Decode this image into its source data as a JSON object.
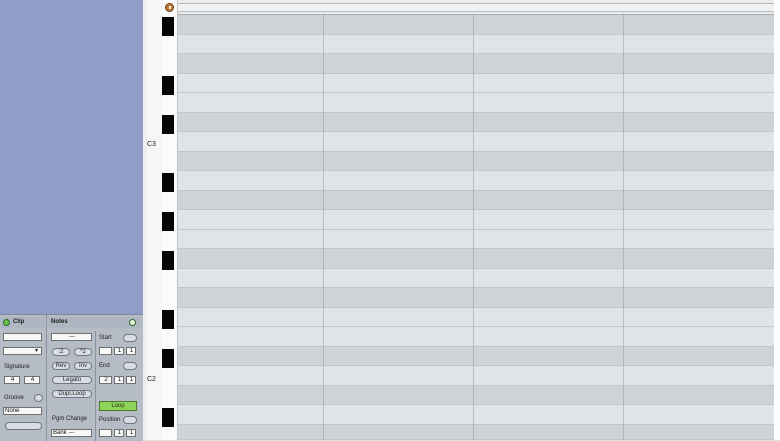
{
  "piano_roll": {
    "note_labels": {
      "c3": "C3",
      "c2": "C2"
    }
  },
  "clip_panel": {
    "clip_title": "Clip",
    "signature_label": "Signature",
    "signature_numerator": "4",
    "signature_denominator": "4",
    "groove_label": "Groove",
    "groove_value": "None"
  },
  "notes_panel": {
    "title": "Notes",
    "dash_value": "---",
    "halve_label": ":2",
    "double_label": "*2",
    "reverse_label": "Rev",
    "invert_label": "Inv",
    "legato_label": "Legato",
    "dupl_loop_label": "Dupl.Loop",
    "pgm_change_label": "Pgm Change",
    "bank_value": "Bank ---"
  },
  "loop_panel": {
    "start_label": "Start",
    "start_values": [
      "",
      "1",
      "1"
    ],
    "end_label": "End",
    "end_values": [
      "2",
      "1",
      "1"
    ],
    "loop_label": "Loop",
    "position_label": "Position",
    "position_values": [
      "",
      "1",
      "1"
    ]
  },
  "colors": {
    "browser_blue": "#8f9dc8",
    "loop_green": "#8fd45a",
    "led_green": "#6bc24a"
  }
}
